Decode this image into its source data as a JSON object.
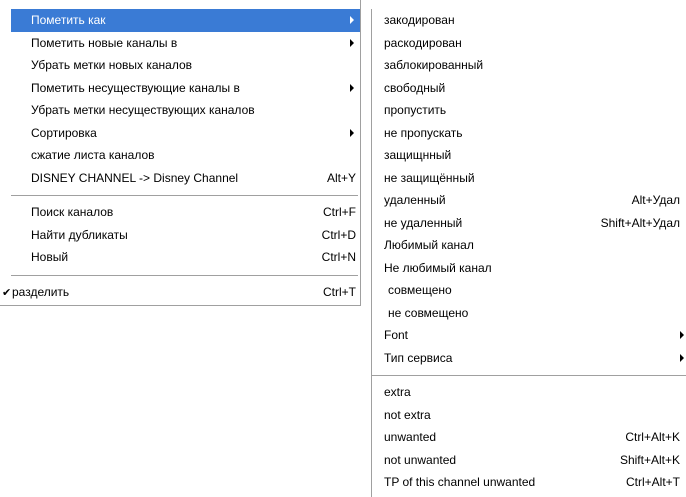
{
  "main_menu": {
    "group1": [
      {
        "label": "Пометить как",
        "shortcut": "",
        "submenu": true,
        "highlighted": true
      },
      {
        "label": "Пометить новые каналы в",
        "shortcut": "",
        "submenu": true
      },
      {
        "label": "Убрать метки новых каналов",
        "shortcut": "",
        "submenu": false
      },
      {
        "label": "Пометить несуществующие каналы в",
        "shortcut": "",
        "submenu": true
      },
      {
        "label": "Убрать метки несуществующих каналов",
        "shortcut": "",
        "submenu": false
      },
      {
        "label": "Сортировка",
        "shortcut": "",
        "submenu": true
      },
      {
        "label": "сжатие листа каналов",
        "shortcut": "",
        "submenu": false
      },
      {
        "label": "DISNEY CHANNEL -> Disney Channel",
        "shortcut": "Alt+Y",
        "submenu": false
      }
    ],
    "group2": [
      {
        "label": "Поиск каналов",
        "shortcut": "Ctrl+F"
      },
      {
        "label": "Найти дубликаты",
        "shortcut": "Ctrl+D"
      },
      {
        "label": "Новый",
        "shortcut": "Ctrl+N"
      }
    ],
    "group3": [
      {
        "check": "✔",
        "label": "разделить",
        "shortcut": "Ctrl+T"
      }
    ]
  },
  "sub_menu": {
    "group1": [
      {
        "label": "закодирован",
        "shortcut": ""
      },
      {
        "label": "раскодирован",
        "shortcut": ""
      },
      {
        "label": "заблокированный",
        "shortcut": ""
      },
      {
        "label": "свободный",
        "shortcut": ""
      },
      {
        "label": "пропустить",
        "shortcut": ""
      },
      {
        "label": "не пропускать",
        "shortcut": ""
      },
      {
        "label": "защищнный",
        "shortcut": ""
      },
      {
        "label": "не защищённый",
        "shortcut": ""
      },
      {
        "label": "удаленный",
        "shortcut": "Alt+Удал"
      },
      {
        "label": "не удаленный",
        "shortcut": "Shift+Alt+Удал"
      },
      {
        "label": "Любимый канал",
        "shortcut": ""
      },
      {
        "label": "Не любимый канал",
        "shortcut": ""
      },
      {
        "label": "совмещено",
        "shortcut": ""
      },
      {
        "label": "не совмещено",
        "shortcut": ""
      },
      {
        "label": "Font",
        "shortcut": "",
        "submenu": true
      },
      {
        "label": "Тип сервиса",
        "shortcut": "",
        "submenu": true
      }
    ],
    "group2": [
      {
        "label": "extra",
        "shortcut": ""
      },
      {
        "label": "not extra",
        "shortcut": ""
      },
      {
        "label": "unwanted",
        "shortcut": "Ctrl+Alt+K"
      },
      {
        "label": "not unwanted",
        "shortcut": "Shift+Alt+K"
      },
      {
        "label": "TP of this channel unwanted",
        "shortcut": "Ctrl+Alt+T"
      }
    ]
  },
  "colors": {
    "highlight": "#3a7bd5",
    "separator": "#a0a0a0"
  }
}
